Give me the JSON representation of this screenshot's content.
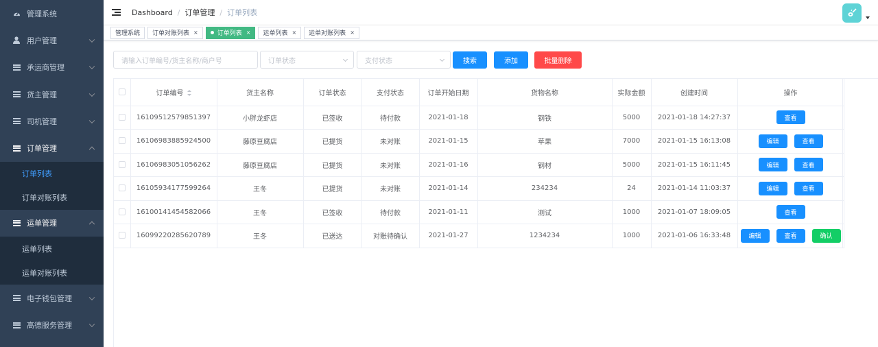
{
  "sidebar": {
    "items": [
      {
        "label": "管理系统",
        "icon": "dashboard-icon"
      },
      {
        "label": "用户管理",
        "icon": "user-icon"
      },
      {
        "label": "承运商管理",
        "icon": "list-icon"
      },
      {
        "label": "货主管理",
        "icon": "list-icon"
      },
      {
        "label": "司机管理",
        "icon": "list-icon"
      },
      {
        "label": "订单管理",
        "icon": "list-icon",
        "sub": [
          "订单列表",
          "订单对账列表"
        ]
      },
      {
        "label": "运单管理",
        "icon": "list-icon",
        "sub": [
          "运单列表",
          "运单对账列表"
        ]
      },
      {
        "label": "电子钱包管理",
        "icon": "list-icon"
      },
      {
        "label": "高德服务管理",
        "icon": "list-icon"
      }
    ]
  },
  "breadcrumb": [
    "Dashboard",
    "订单管理",
    "订单列表"
  ],
  "tags": [
    {
      "label": "管理系统"
    },
    {
      "label": "订单对账列表"
    },
    {
      "label": "订单列表"
    },
    {
      "label": "运单列表"
    },
    {
      "label": "运单对账列表"
    }
  ],
  "filters": {
    "search_placeholder": "请输入订单编号/货主名称/商户号",
    "order_status_placeholder": "订单状态",
    "pay_status_placeholder": "支付状态",
    "search_label": "搜索",
    "add_label": "添加",
    "batch_delete_label": "批量删除"
  },
  "table": {
    "headers": [
      "订单编号",
      "货主名称",
      "订单状态",
      "支付状态",
      "订单开始日期",
      "货物名称",
      "实际金额",
      "创建时间",
      "操作"
    ],
    "edit_label": "编辑",
    "view_label": "查看",
    "confirm_label": "确认",
    "rows": [
      {
        "id": "16109512579851397",
        "owner": "小胖龙虾店",
        "order_status": "已签收",
        "pay_status": "待付款",
        "start": "2021-01-18",
        "goods": "钢铁",
        "amount": "5000",
        "created": "2021-01-18 14:27:37"
      },
      {
        "id": "16106983885924500",
        "owner": "藤原豆腐店",
        "order_status": "已提货",
        "pay_status": "未对账",
        "start": "2021-01-15",
        "goods": "苹果",
        "amount": "7000",
        "created": "2021-01-15 16:13:08"
      },
      {
        "id": "16106983051056262",
        "owner": "藤原豆腐店",
        "order_status": "已提货",
        "pay_status": "未对账",
        "start": "2021-01-16",
        "goods": "钢材",
        "amount": "5000",
        "created": "2021-01-15 16:11:45"
      },
      {
        "id": "16105934177599264",
        "owner": "王冬",
        "order_status": "已提货",
        "pay_status": "未对账",
        "start": "2021-01-14",
        "goods": "234234",
        "amount": "24",
        "created": "2021-01-14 11:03:37"
      },
      {
        "id": "16100141454582066",
        "owner": "王冬",
        "order_status": "已签收",
        "pay_status": "待付款",
        "start": "2021-01-11",
        "goods": "测试",
        "amount": "1000",
        "created": "2021-01-07 18:09:05"
      },
      {
        "id": "16099220285620789",
        "owner": "王冬",
        "order_status": "已送达",
        "pay_status": "对账待确认",
        "start": "2021-01-27",
        "goods": "1234234",
        "amount": "1000",
        "created": "2021-01-06 16:33:48"
      }
    ]
  }
}
